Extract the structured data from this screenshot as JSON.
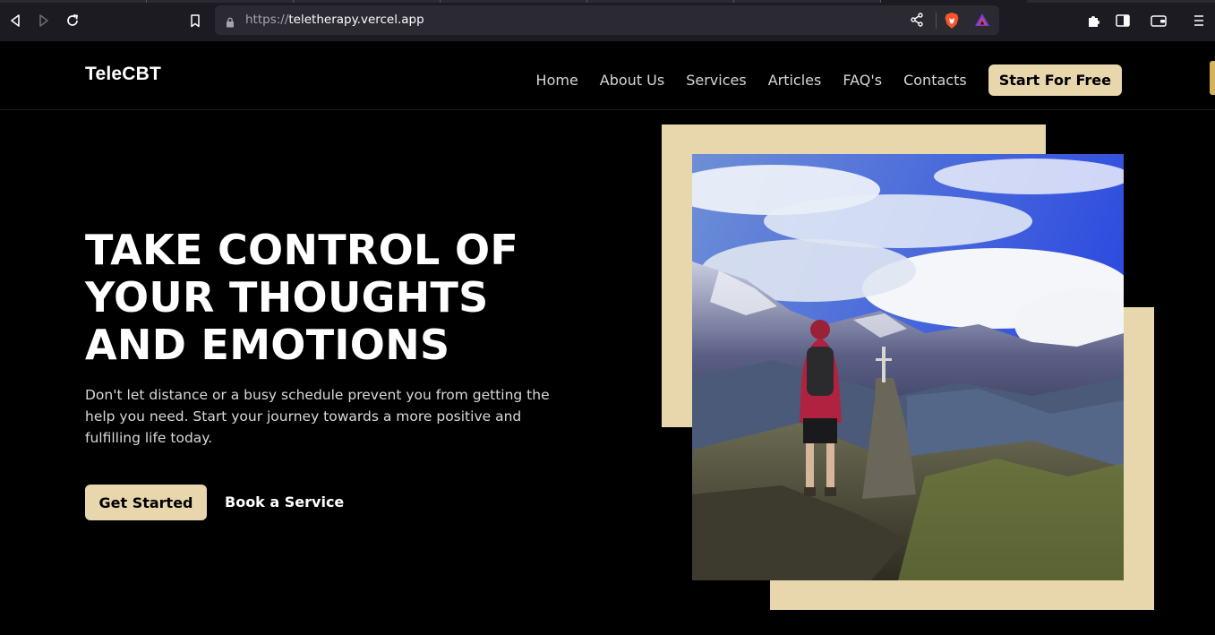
{
  "browser": {
    "url_protocol": "https://",
    "url_host": "teletherapy.vercel.app",
    "icons": {
      "back": "back-arrow-icon",
      "forward": "forward-arrow-icon",
      "reload": "reload-icon",
      "bookmark": "bookmark-icon",
      "lock": "lock-icon",
      "share": "share-icon",
      "shields": "brave-shields-icon",
      "rewards": "brave-rewards-icon",
      "extensions": "puzzle-extensions-icon",
      "sidebar": "sidebar-toggle-icon",
      "wallet": "wallet-icon",
      "menu": "hamburger-menu-icon"
    }
  },
  "site": {
    "logo": "TeleCBT",
    "nav": [
      {
        "label": "Home"
      },
      {
        "label": "About Us"
      },
      {
        "label": "Services"
      },
      {
        "label": "Articles"
      },
      {
        "label": "FAQ's"
      },
      {
        "label": "Contacts"
      }
    ],
    "cta_label": "Start For Free",
    "hero": {
      "headline_lines": [
        "TAKE CONTROL OF",
        "YOUR THOUGHTS",
        "AND EMOTIONS"
      ],
      "subtext": "Don't let distance or a busy schedule prevent you from getting the help you need. Start your journey towards a more positive and fulfilling life today.",
      "primary_button": "Get Started",
      "secondary_button": "Book a Service"
    },
    "colors": {
      "accent": "#e8d6ad",
      "background": "#000000"
    }
  }
}
